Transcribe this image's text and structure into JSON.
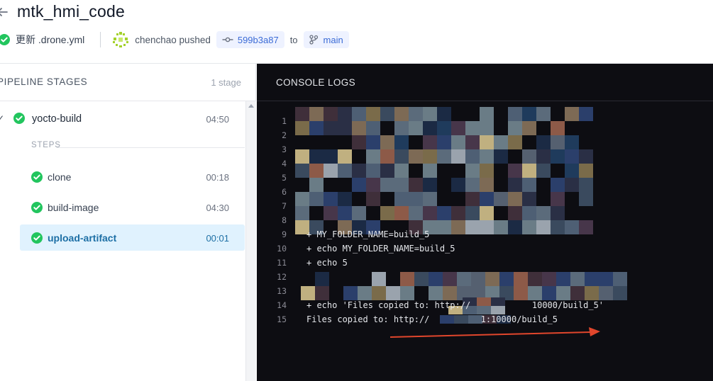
{
  "header": {
    "title": "mtk_hmi_code",
    "commit_message": "更新 .drone.yml",
    "author_action": "chenchao pushed",
    "commit_hash": "599b3a87",
    "to_label": "to",
    "branch": "main"
  },
  "pipeline": {
    "heading": "PIPELINE STAGES",
    "stage_count": "1 stage",
    "stage": {
      "name": "yocto-build",
      "duration": "04:50"
    },
    "steps_label": "STEPS",
    "steps": [
      {
        "name": "clone",
        "duration": "00:18",
        "active": false
      },
      {
        "name": "build-image",
        "duration": "04:30",
        "active": false
      },
      {
        "name": "upload-artifact",
        "duration": "00:01",
        "active": true
      }
    ]
  },
  "console": {
    "heading": "CONSOLE LOGS",
    "lines": [
      {
        "num": "1",
        "text": ""
      },
      {
        "num": "2",
        "text": ""
      },
      {
        "num": "3",
        "text": ""
      },
      {
        "num": "4",
        "text": ""
      },
      {
        "num": "5",
        "text": ""
      },
      {
        "num": "6",
        "text": ""
      },
      {
        "num": "7",
        "text": ""
      },
      {
        "num": "8",
        "text": ""
      },
      {
        "num": "9",
        "text": "+ MY_FOLDER_NAME=build_5"
      },
      {
        "num": "10",
        "text": "+ echo MY_FOLDER_NAME=build_5"
      },
      {
        "num": "11",
        "text": "+ echo 5"
      },
      {
        "num": "12",
        "text": ""
      },
      {
        "num": "13",
        "text": ""
      },
      {
        "num": "14",
        "text": "+ echo 'Files copied to: http://            10000/build_5'"
      },
      {
        "num": "15",
        "text": "Files copied to: http://          1:10000/build_5"
      }
    ]
  },
  "colors": {
    "success": "#22c55e",
    "accent": "#3b6bd6",
    "console_bg": "#0d0d12",
    "arrow": "#e0462c"
  }
}
